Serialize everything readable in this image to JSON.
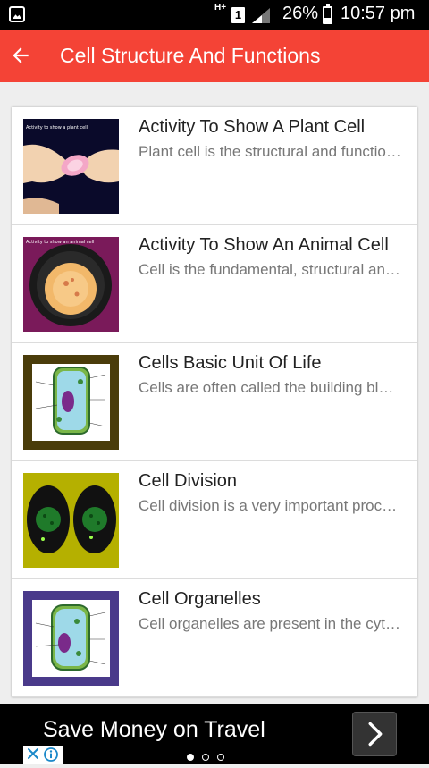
{
  "status_bar": {
    "network": "H+",
    "sim": "1",
    "battery_percent": "26%",
    "time": "10:57 pm"
  },
  "app_bar": {
    "title": "Cell Structure And Functions",
    "back_icon": "arrow-left-icon",
    "background": "#f44336"
  },
  "topics": [
    {
      "title": "Activity To Show A Plant Cell",
      "description": "Plant cell is the structural and functional unit of plants",
      "thumb_caption": "Activity to show a plant cell"
    },
    {
      "title": "Activity To Show An Animal Cell",
      "description": "Cell is the fundamental, structural and functional unit",
      "thumb_caption": "Activity to show an animal cell"
    },
    {
      "title": "Cells Basic Unit Of Life",
      "description": "Cells are often called the building blocks of life"
    },
    {
      "title": "Cell Division",
      "description": "Cell division is a very important process"
    },
    {
      "title": "Cell Organelles",
      "description": "Cell organelles are present in the cytoplasm"
    }
  ],
  "ad": {
    "text": "Save Money on Travel",
    "arrow_icon": "chevron-right-icon",
    "carousel_pages": 3,
    "carousel_active": 1
  }
}
